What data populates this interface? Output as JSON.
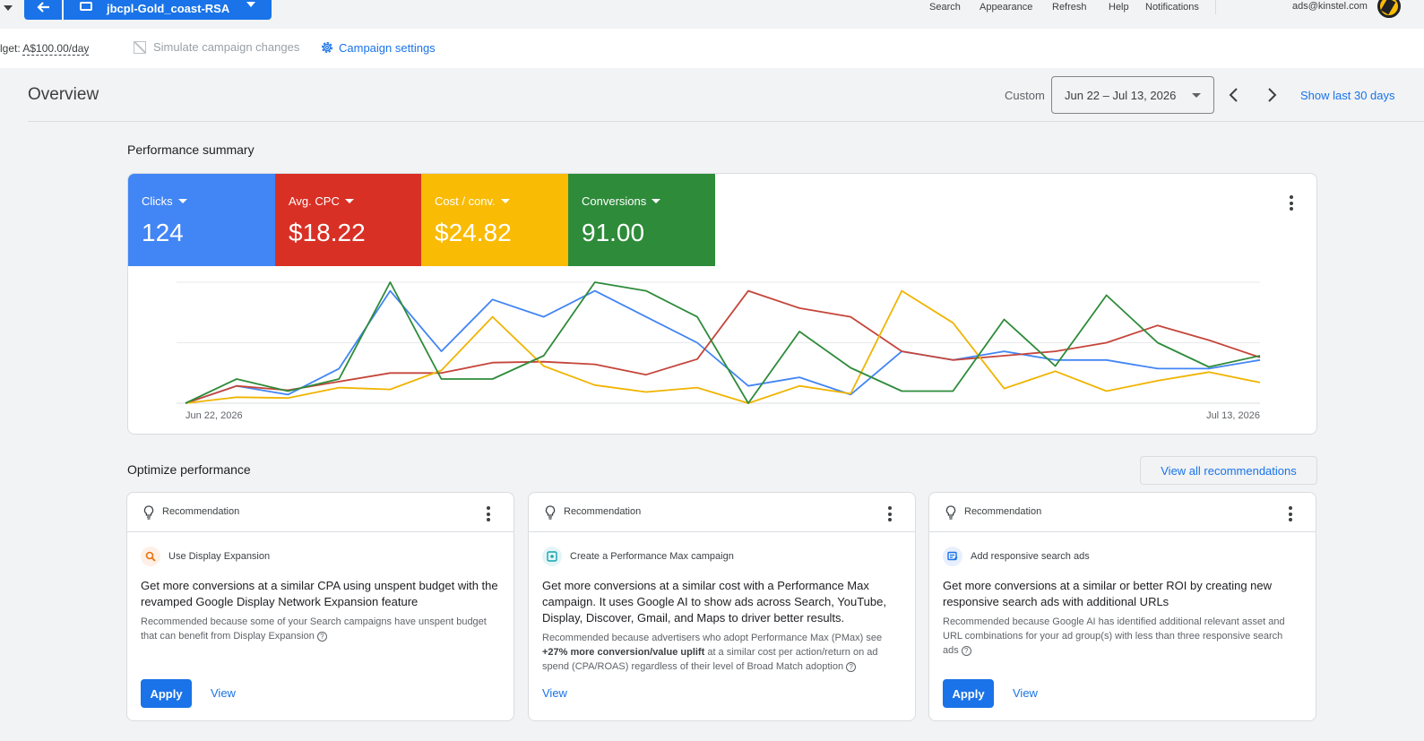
{
  "topbar": {
    "campaign_name": "jbcpl-Gold_coast-RSA",
    "menu": [
      "Search",
      "Appearance",
      "Refresh",
      "Help",
      "Notifications"
    ],
    "user_email": "ads@kinstel.com"
  },
  "subbar": {
    "budget_label": "lget:",
    "budget_value": "A$100.00/day",
    "simulate_label": "Simulate campaign changes",
    "settings_label": "Campaign settings"
  },
  "overview": {
    "title": "Overview",
    "range_type": "Custom",
    "date_range": "Jun 22 – Jul 13, 2026",
    "show_last": "Show last 30 days"
  },
  "performance": {
    "title": "Performance summary",
    "metrics": [
      {
        "label": "Clicks",
        "value": "124",
        "color": "#4285f4"
      },
      {
        "label": "Avg. CPC",
        "value": "$18.22",
        "color": "#d93025"
      },
      {
        "label": "Cost / conv.",
        "value": "$24.82",
        "color": "#f9bb04"
      },
      {
        "label": "Conversions",
        "value": "91.00",
        "color": "#2e8b3a"
      }
    ]
  },
  "chart_data": {
    "type": "line",
    "x_start_label": "Jun 22, 2026",
    "x_end_label": "Jul 13, 2026",
    "ylim": [
      0,
      14
    ],
    "grid": true,
    "series": [
      {
        "name": "Clicks",
        "color": "#4285f4",
        "values": [
          0,
          2,
          1,
          4,
          13,
          6,
          12,
          10,
          13,
          10,
          7,
          2,
          3,
          1,
          6,
          5,
          6,
          5,
          5,
          4,
          4,
          5
        ]
      },
      {
        "name": "Avg. CPC",
        "color": "#c5453a",
        "values": [
          0,
          2,
          1.5,
          2.5,
          3.5,
          3.5,
          4.7,
          4.8,
          4.5,
          3.3,
          5.1,
          13,
          11,
          10,
          6,
          5,
          5.5,
          6,
          7,
          9,
          7.3,
          5.3
        ]
      },
      {
        "name": "Cost / conv.",
        "color": "#f0b400",
        "values": [
          0,
          0.7,
          0.6,
          1.8,
          1.6,
          3.8,
          10,
          4.3,
          2.1,
          1.3,
          1.8,
          0,
          2,
          1.1,
          13,
          9.3,
          1.7,
          3.7,
          1.4,
          2.6,
          3.6,
          2.4
        ]
      },
      {
        "name": "Conversions",
        "color": "#2e8b3a",
        "values": [
          0,
          2.8,
          1.4,
          2.8,
          14,
          2.8,
          2.8,
          5.5,
          14,
          13,
          10,
          0,
          8.3,
          4.1,
          1.4,
          1.4,
          9.7,
          4.3,
          12.5,
          7,
          4.2,
          5.5
        ]
      }
    ]
  },
  "optimize": {
    "title": "Optimize performance",
    "view_all": "View all recommendations",
    "cards": [
      {
        "header": "Recommendation",
        "type_label": "Use Display Expansion",
        "main": "Get more conversions at a similar CPA using unspent budget with the revamped Google Display Network Expansion feature",
        "why": "Recommended because some of your Search campaigns have unspent budget that can benefit from Display Expansion",
        "apply": "Apply",
        "view": "View"
      },
      {
        "header": "Recommendation",
        "type_label": "Create a Performance Max campaign",
        "main": "Get more conversions at a similar cost with a Performance Max campaign. It uses Google AI to show ads across Search, YouTube, Display, Discover, Gmail, and Maps to driver better results.",
        "why_pre": "Recommended because advertisers who adopt Performance Max (PMax) see",
        "why_bold": "+27% more conversion/value uplift",
        "why_post": "at a similar cost per action/return on ad spend (CPA/ROAS) regardless of their level of Broad Match adoption",
        "view": "View"
      },
      {
        "header": "Recommendation",
        "type_label": "Add responsive search ads",
        "main": "Get more conversions at a similar or better ROI by creating new responsive search ads with additional URLs",
        "why": "Recommended because Google AI has identified additional relevant asset and URL combinations for your ad group(s) with less than three responsive search ads",
        "apply": "Apply",
        "view": "View"
      }
    ]
  }
}
